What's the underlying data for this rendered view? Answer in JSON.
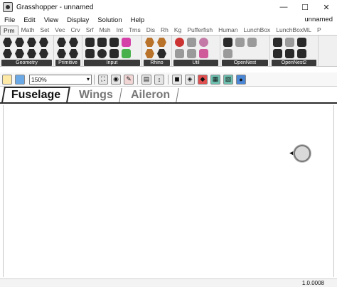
{
  "window": {
    "title": "Grasshopper - unnamed",
    "minimize": "—",
    "maximize": "☐",
    "close": "✕"
  },
  "menu": {
    "items": [
      "File",
      "Edit",
      "View",
      "Display",
      "Solution",
      "Help"
    ],
    "document_name": "unnamed"
  },
  "ribbon_tabs": [
    "Prm",
    "Math",
    "Set",
    "Vec",
    "Crv",
    "Srf",
    "Msh",
    "Int",
    "Trns",
    "Dis",
    "Rh",
    "Kg",
    "Pufferfish",
    "Human",
    "LunchBox",
    "LunchBoxML",
    "P"
  ],
  "active_ribbon_tab": "Prm",
  "ribbon_groups": [
    {
      "label": "Geometry",
      "icons": [
        "geometry-icon",
        "geometry-icon",
        "geometry-icon",
        "geometry-icon",
        "geometry-icon",
        "geometry-icon",
        "geometry-icon",
        "geometry-icon"
      ]
    },
    {
      "label": "Primitive",
      "icons": [
        "primitive-icon",
        "primitive-icon",
        "primitive-icon",
        "primitive-icon",
        "primitive-icon",
        "primitive-icon"
      ]
    },
    {
      "label": "Input",
      "icons": [
        "input-icon",
        "input-icon",
        "input-icon",
        "input-icon",
        "input-icon",
        "input-icon",
        "input-icon",
        "input-icon",
        "input-icon"
      ]
    },
    {
      "label": "Rhino",
      "icons": [
        "rhino-icon",
        "rhino-icon",
        "rhino-icon",
        "rhino-icon"
      ]
    },
    {
      "label": "Util",
      "icons": [
        "util-icon",
        "util-icon",
        "util-icon",
        "util-icon",
        "util-icon",
        "util-icon"
      ]
    },
    {
      "label": "OpenNest",
      "icons": [
        "opennest-icon",
        "opennest-icon",
        "opennest-icon",
        "opennest-icon",
        "opennest-icon",
        "opennest-icon"
      ]
    },
    {
      "label": "OpenNest2",
      "icons": [
        "opennest2-icon",
        "opennest2-icon",
        "opennest2-icon",
        "opennest2-icon",
        "opennest2-icon",
        "opennest2-icon"
      ]
    }
  ],
  "toolbar": {
    "zoom": "150%",
    "icons": [
      "open-file-icon",
      "save-icon",
      "zoom-extents-icon",
      "preview-eye-icon",
      "sketch-icon",
      "wire-display-icon",
      "solver-icon",
      "shaded-preview-icon",
      "preview-mode-icon",
      "selected-only-icon",
      "mesh-quality-icon",
      "colour-sphere-icon"
    ]
  },
  "document_tabs": [
    "Fuselage",
    "Wings",
    "Aileron"
  ],
  "active_document_tab": "Fuselage",
  "status": {
    "version": "1.0.0008"
  }
}
